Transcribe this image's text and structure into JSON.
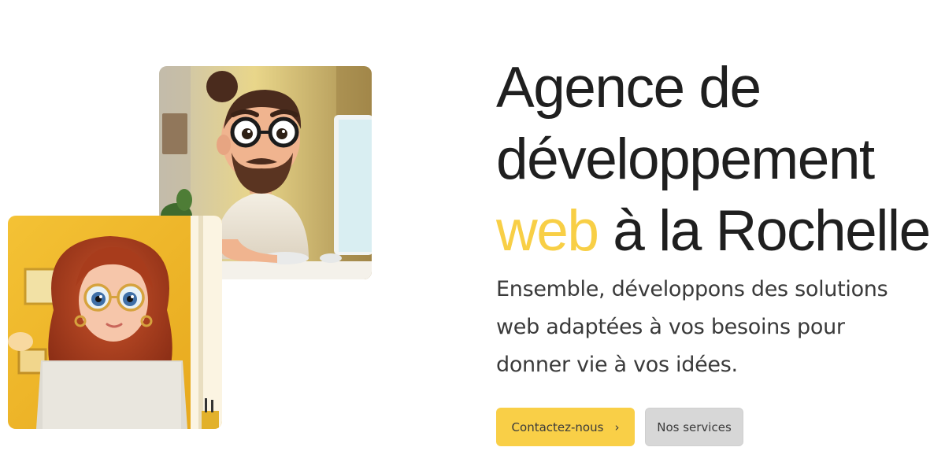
{
  "hero": {
    "headline": {
      "line1": "Agence de",
      "line2": "développement",
      "accent_word": "web",
      "line3_rest": " à la Rochelle"
    },
    "subtitle": {
      "line1": "Ensemble, développons des solutions",
      "line2": "web adaptées à vos besoins pour",
      "line3": "donner vie à vos idées."
    },
    "buttons": {
      "primary_label": "Contactez-nous",
      "primary_icon": "chevron-right-icon",
      "secondary_label": "Nos services"
    }
  },
  "images": {
    "man": "developer-man-illustration",
    "woman": "developer-woman-illustration"
  },
  "colors": {
    "accent": "#f8cf46",
    "primary_button": "#f9cf47",
    "secondary_button": "#d7d7d7",
    "text": "#1f1f1f"
  }
}
